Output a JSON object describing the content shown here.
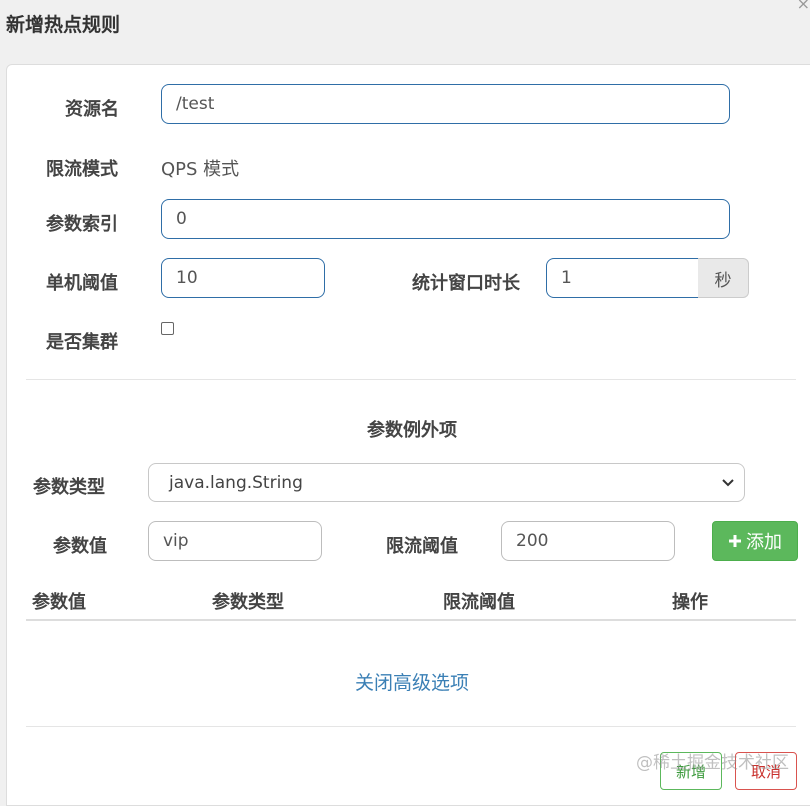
{
  "dialog": {
    "title": "新增热点规则"
  },
  "form": {
    "resource_label": "资源名",
    "resource_value": "/test",
    "mode_label": "限流模式",
    "mode_value": "QPS 模式",
    "param_index_label": "参数索引",
    "param_index_value": "0",
    "threshold_label": "单机阈值",
    "threshold_value": "10",
    "window_label": "统计窗口时长",
    "window_value": "1",
    "window_unit": "秒",
    "cluster_label": "是否集群",
    "cluster_checked": false
  },
  "exceptions": {
    "section_title": "参数例外项",
    "param_type_label": "参数类型",
    "param_type_value": "java.lang.String",
    "param_value_label": "参数值",
    "param_value": "vip",
    "limit_label": "限流阈值",
    "limit_value": "200",
    "add_button": "添加",
    "table_headers": [
      "参数值",
      "参数类型",
      "限流阈值",
      "操作"
    ]
  },
  "footer": {
    "toggle_link": "关闭高级选项",
    "new_button": "新增",
    "cancel_button": "取消",
    "watermark": "@稀土掘金技术社区"
  }
}
